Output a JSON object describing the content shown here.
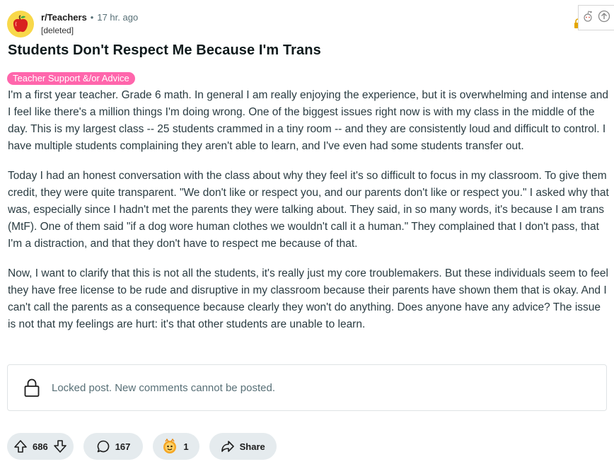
{
  "post": {
    "subreddit": "r/Teachers",
    "separator": "•",
    "time": "17 hr. ago",
    "author": "[deleted]",
    "title": "Students Don't Respect Me Because I'm Trans",
    "flair": "Teacher Support &/or Advice",
    "flair_color": "#ff66ac",
    "paragraphs": [
      "I'm a first year teacher. Grade 6 math. In general I am really enjoying the experience, but it is overwhelming and intense and I feel like there's a million things I'm doing wrong. One of the biggest issues right now is with my class in the middle of the day. This is my largest class -- 25 students crammed in a tiny room -- and they are consistently loud and difficult to control. I have multiple students complaining they aren't able to learn, and I've even had some students transfer out.",
      "Today I had an honest conversation with the class about why they feel it's so difficult to focus in my classroom. To give them credit, they were quite transparent. \"We don't like or respect you, and our parents don't like or respect you.\" I asked why that was, especially since I hadn't met the parents they were talking about. They said, in so many words, it's because I am trans (MtF). One of them said \"if a dog wore human clothes we wouldn't call it a human.\" They complained that I don't pass, that I'm a distraction, and that they don't have to respect me because of that.",
      "Now, I want to clarify that this is not all the students, it's really just my core troublemakers. But these individuals seem to feel they have free license to be rude and disruptive in my classroom because their parents have shown them that is okay. And I can't call the parents as a consequence because clearly they won't do anything. Does anyone have any advice? The issue is not that my feelings are hurt: it's that other students are unable to learn."
    ],
    "locked_message": "Locked post. New comments cannot be posted.",
    "votes": "686",
    "comments": "167",
    "awards": "1",
    "share_label": "Share"
  },
  "icons": {
    "avatar": "apple-icon",
    "upvote": "arrow-up-icon",
    "downvote": "arrow-down-icon",
    "comment": "speech-bubble-icon",
    "award": "award-icon",
    "share": "share-arrow-icon",
    "lock": "lock-icon"
  },
  "colors": {
    "pill_bg": "#e5ebee",
    "text": "#1c1c1c",
    "muted": "#576f76",
    "body_text": "#2a3c42"
  }
}
